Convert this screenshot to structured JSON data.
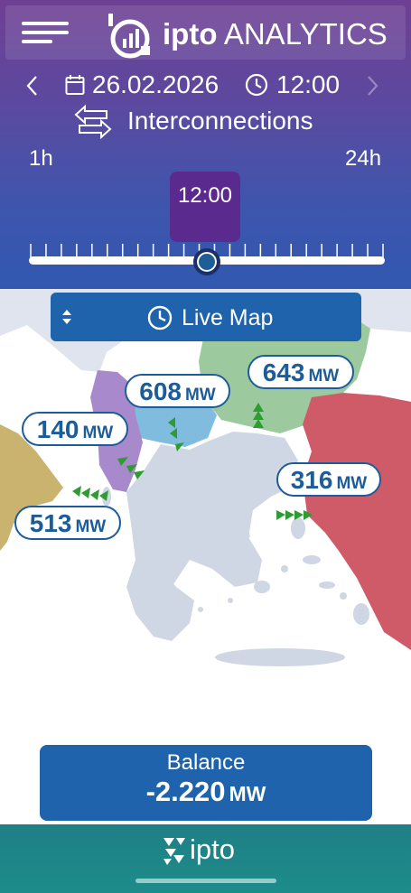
{
  "header": {
    "brand_bold": "ipto",
    "brand_rest": "ANALYTICS",
    "date": "26.02.2026",
    "time": "12:00",
    "section_title": "Interconnections",
    "range_min": "1h",
    "range_max": "24h",
    "slider_time": "12:00",
    "slider_level": 0.5
  },
  "icons": [
    "menu-icon",
    "logo-icon",
    "chevron-left-icon",
    "calendar-icon",
    "clock-icon",
    "chevron-right-icon",
    "swap-arrows-icon",
    "sort-icon"
  ],
  "map": {
    "live_button_label": "Live Map",
    "flows": [
      {
        "id": "albania",
        "value": "140",
        "unit": "MW"
      },
      {
        "id": "north-macedonia",
        "value": "608",
        "unit": "MW"
      },
      {
        "id": "bulgaria",
        "value": "643",
        "unit": "MW"
      },
      {
        "id": "turkey",
        "value": "316",
        "unit": "MW"
      },
      {
        "id": "italy",
        "value": "513",
        "unit": "MW"
      }
    ],
    "colors": {
      "albania": "#a889cc",
      "north_macedonia": "#7fbcdd",
      "bulgaria": "#9cc99e",
      "turkey": "#cf5a68",
      "italy": "#c9b36f",
      "greece": "#cfd6e4",
      "other_land": "#dfe4ee",
      "arrows": "#2e9b33"
    }
  },
  "balance": {
    "label": "Balance",
    "value": "-2.220",
    "unit": "MW"
  },
  "footer": {
    "brand": "ipto"
  }
}
